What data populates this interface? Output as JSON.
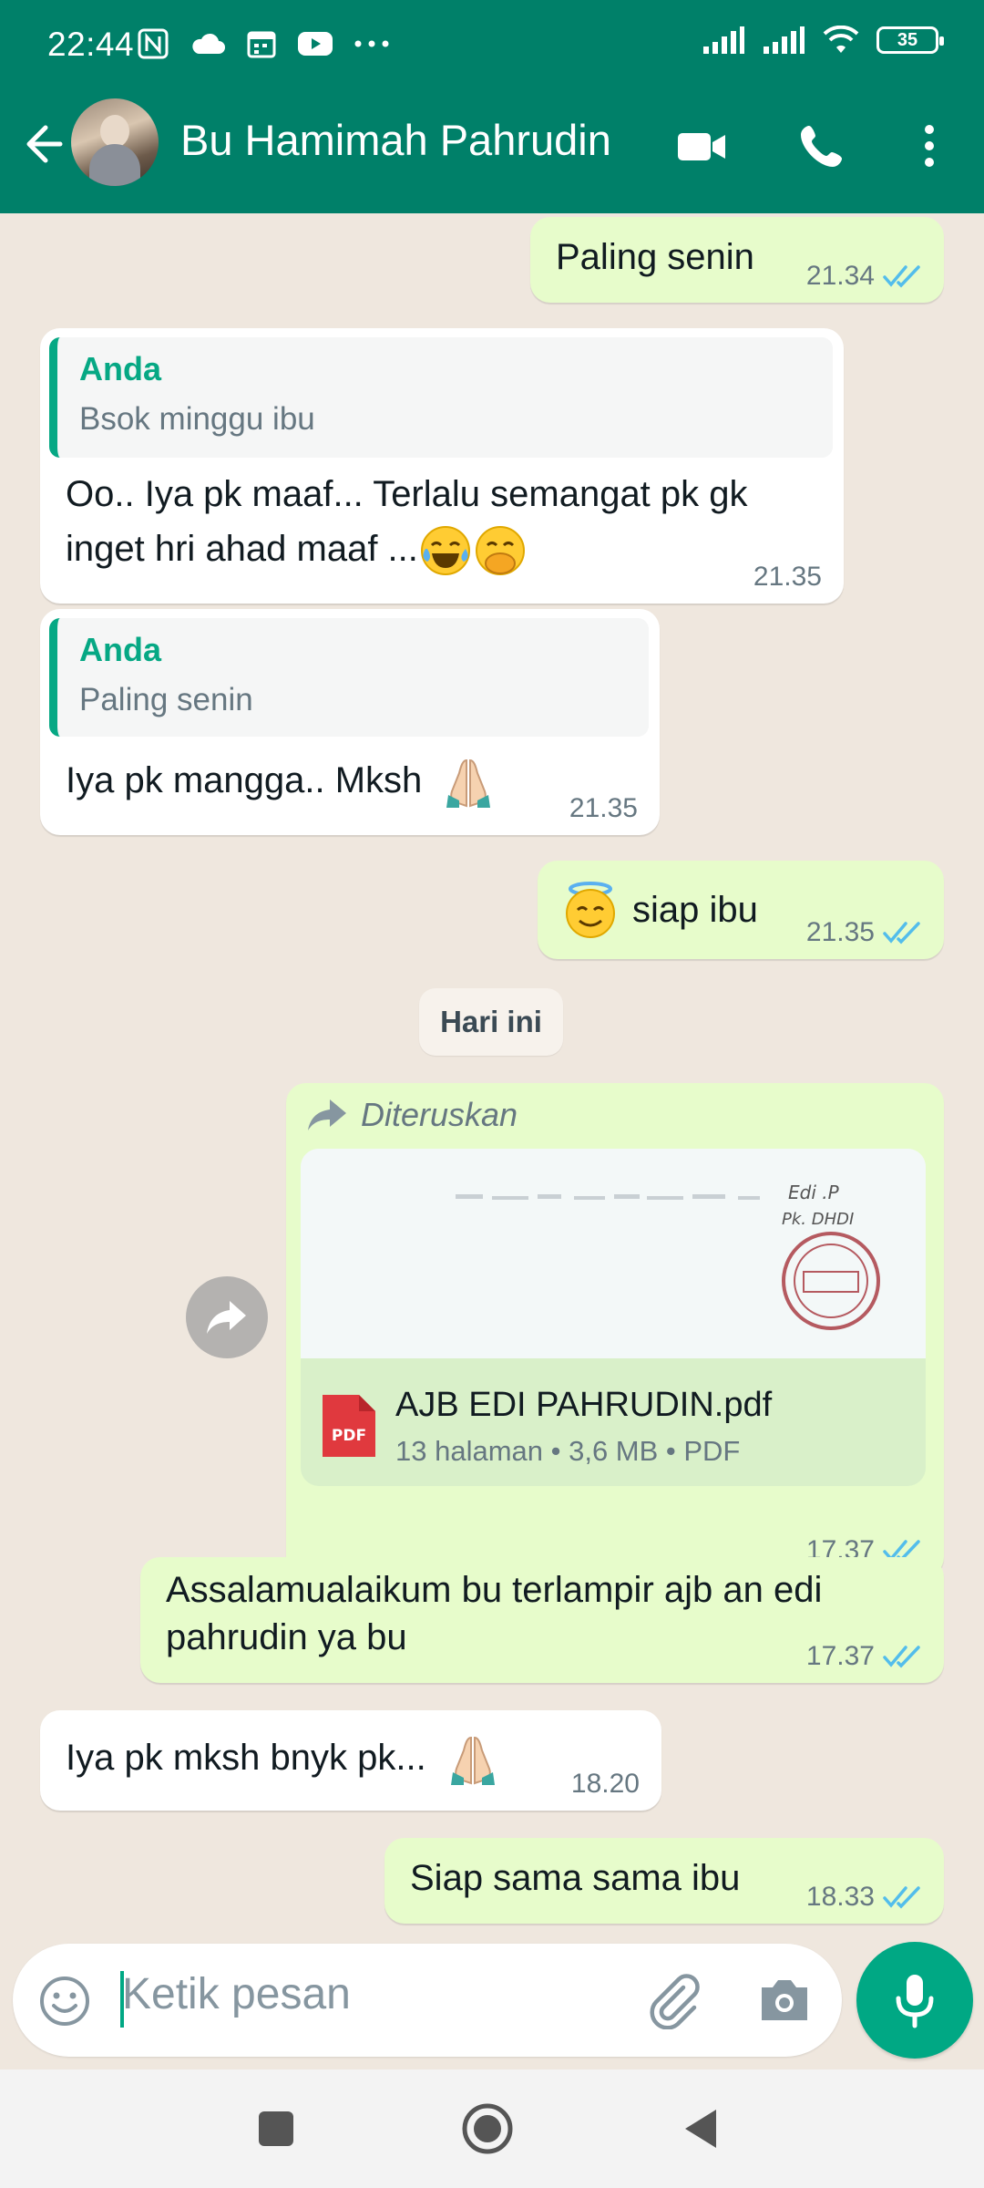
{
  "status_bar": {
    "time": "22:44",
    "battery": "35"
  },
  "header": {
    "contact_name": "Bu Hamimah Pahrudin"
  },
  "messages": [
    {
      "dir": "out",
      "text": "Paling senin",
      "time": "21.34"
    },
    {
      "dir": "in",
      "quote_author": "Anda",
      "quote_text": "Bsok minggu ibu",
      "text_line1": "Oo.. Iya pk maaf... Terlalu semangat pk gk",
      "text_line2": "inget hri ahad maaf  ...",
      "time": "21.35"
    },
    {
      "dir": "in",
      "quote_author": "Anda",
      "quote_text": "Paling senin",
      "text": "Iya pk mangga.. Mksh",
      "time": "21.35"
    },
    {
      "dir": "out",
      "text": "siap ibu",
      "time": "21.35"
    },
    {
      "dir": "out",
      "forwarded_label": "Diteruskan",
      "file_name": "AJB EDI PAHRUDIN.pdf",
      "file_info": "13 halaman • 3,6 MB • PDF",
      "pdf_badge": "PDF",
      "time": "17.37"
    },
    {
      "dir": "out",
      "text_line1": "Assalamualaikum bu terlampir ajb an edi",
      "text_line2": "pahrudin ya bu",
      "time": "17.37"
    },
    {
      "dir": "in",
      "text": "Iya pk mksh bnyk pk...",
      "time": "18.20"
    },
    {
      "dir": "out",
      "text": "Siap sama sama ibu",
      "time": "18.33"
    }
  ],
  "day_separator": "Hari ini",
  "input": {
    "placeholder": "Ketik pesan"
  },
  "colors": {
    "header": "#008069",
    "accent": "#00a884",
    "outgoing_bubble": "#e7fccb",
    "incoming_bubble": "#ffffff",
    "read_tick": "#53bdeb"
  }
}
